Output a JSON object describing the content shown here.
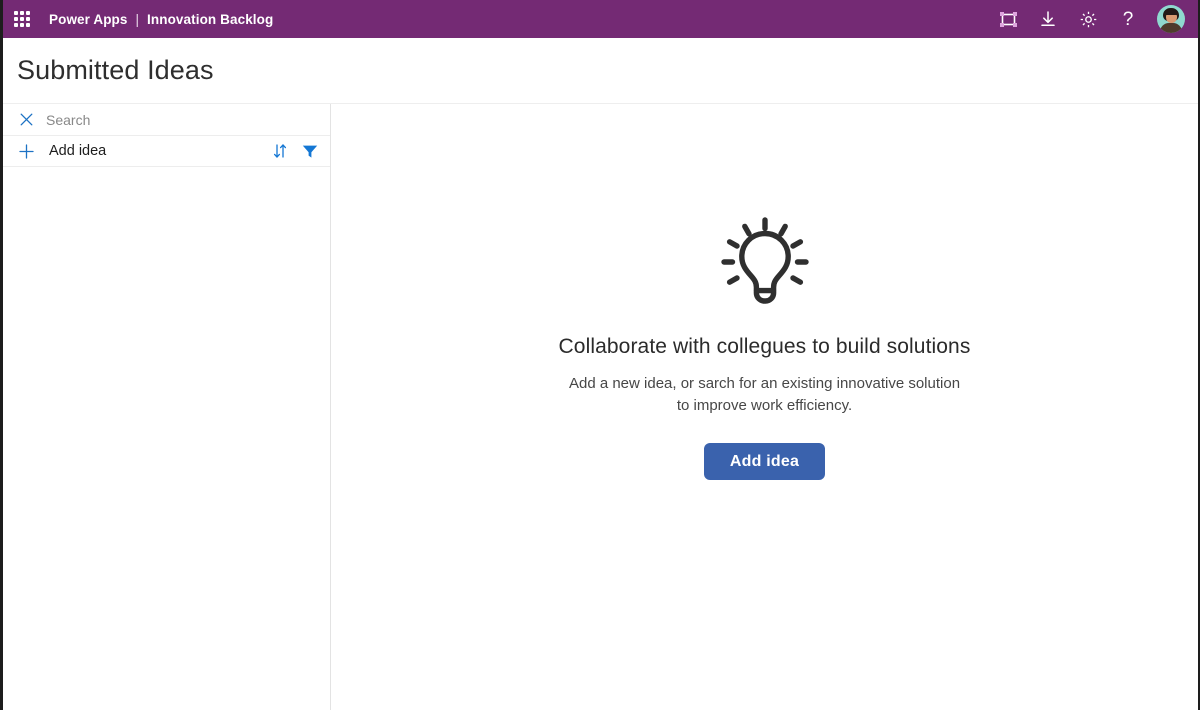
{
  "topbar": {
    "waffle_icon": "app-launcher-waffle-icon",
    "brand": "Power Apps",
    "separator": "|",
    "app_name": "Innovation Backlog",
    "actions": [
      {
        "name": "frame-icon",
        "label": "Edit canvas"
      },
      {
        "name": "download-icon",
        "label": "Download"
      },
      {
        "name": "gear-icon",
        "label": "Settings"
      },
      {
        "name": "help-icon",
        "label": "?"
      }
    ],
    "help_glyph": "?",
    "avatar_label": "Account manager",
    "background_color": "#742A74"
  },
  "page": {
    "title": "Submitted Ideas"
  },
  "left_panel": {
    "search": {
      "clear_icon": "close-icon",
      "placeholder": "Search",
      "value": ""
    },
    "add_row": {
      "plus_icon": "plus-icon",
      "label": "Add idea",
      "sort_icon": "sort-icon",
      "filter_icon": "filter-icon"
    },
    "items": []
  },
  "empty_state": {
    "illustration": "lightbulb-icon",
    "heading": "Collaborate with collegues to build solutions",
    "subtitle": "Add a new idea, or sarch for an existing innovative solution to improve work efficiency.",
    "button_label": "Add idea",
    "button_color": "#3A62AD"
  }
}
